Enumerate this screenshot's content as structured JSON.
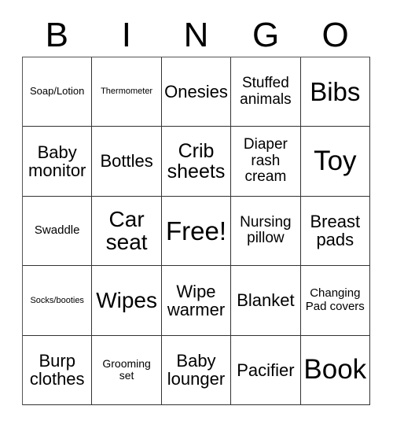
{
  "card": {
    "title_letters": [
      "B",
      "I",
      "N",
      "G",
      "O"
    ],
    "grid_size": "5x5",
    "free_space_label": "Free!",
    "border_color": "#333333",
    "text_color": "#000000",
    "background_color": "#ffffff"
  },
  "rows": [
    {
      "cells": [
        {
          "label": "Soap/Lotion",
          "size": "fs-s"
        },
        {
          "label": "Thermometer",
          "size": "fs-xs"
        },
        {
          "label": "Onesies",
          "size": "fs-l"
        },
        {
          "label": "Stuffed animals",
          "size": "fs-ml"
        },
        {
          "label": "Bibs",
          "size": "fs-huge"
        }
      ]
    },
    {
      "cells": [
        {
          "label": "Baby monitor",
          "size": "fs-l"
        },
        {
          "label": "Bottles",
          "size": "fs-l"
        },
        {
          "label": "Crib sheets",
          "size": "fs-xl"
        },
        {
          "label": "Diaper rash cream",
          "size": "fs-ml"
        },
        {
          "label": "Toy",
          "size": "fs-mega"
        }
      ]
    },
    {
      "cells": [
        {
          "label": "Swaddle",
          "size": "fs-m"
        },
        {
          "label": "Car seat",
          "size": "fs-xxl"
        },
        {
          "label": "Free!",
          "size": "fs-huge"
        },
        {
          "label": "Nursing pillow",
          "size": "fs-ml"
        },
        {
          "label": "Breast pads",
          "size": "fs-l"
        }
      ]
    },
    {
      "cells": [
        {
          "label": "Socks/booties",
          "size": "fs-xs"
        },
        {
          "label": "Wipes",
          "size": "fs-xxl"
        },
        {
          "label": "Wipe warmer",
          "size": "fs-l"
        },
        {
          "label": "Blanket",
          "size": "fs-l"
        },
        {
          "label": "Changing Pad covers",
          "size": "fs-m"
        }
      ]
    },
    {
      "cells": [
        {
          "label": "Burp clothes",
          "size": "fs-l"
        },
        {
          "label": "Grooming set",
          "size": "fs-sm"
        },
        {
          "label": "Baby lounger",
          "size": "fs-l"
        },
        {
          "label": "Pacifier",
          "size": "fs-l"
        },
        {
          "label": "Book",
          "size": "fs-mega"
        }
      ]
    }
  ]
}
